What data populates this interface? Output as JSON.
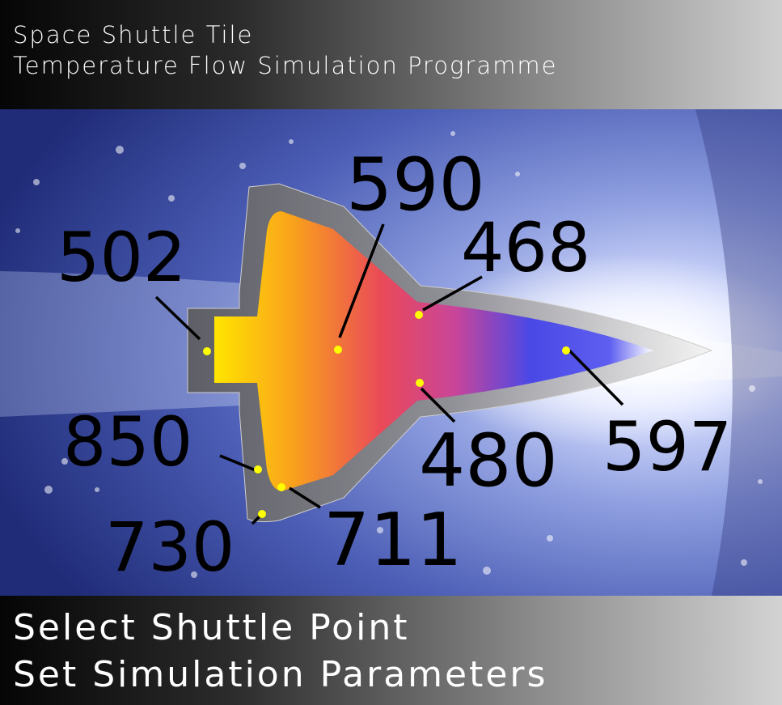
{
  "header": {
    "title_line1": "Space Shuttle Tile",
    "title_line2": "Temperature Flow Simulation Programme"
  },
  "readings": {
    "p502": "502",
    "p590": "590",
    "p468": "468",
    "p850": "850",
    "p480": "480",
    "p597": "597",
    "p711": "711",
    "p730": "730"
  },
  "menu": {
    "select_point": "Select Shuttle Point",
    "set_params": "Set Simulation Parameters"
  },
  "colors": {
    "point_marker": "#ffff00",
    "hot": "#ffe000",
    "mid": "#e8435a",
    "cool": "#3c45e8"
  }
}
